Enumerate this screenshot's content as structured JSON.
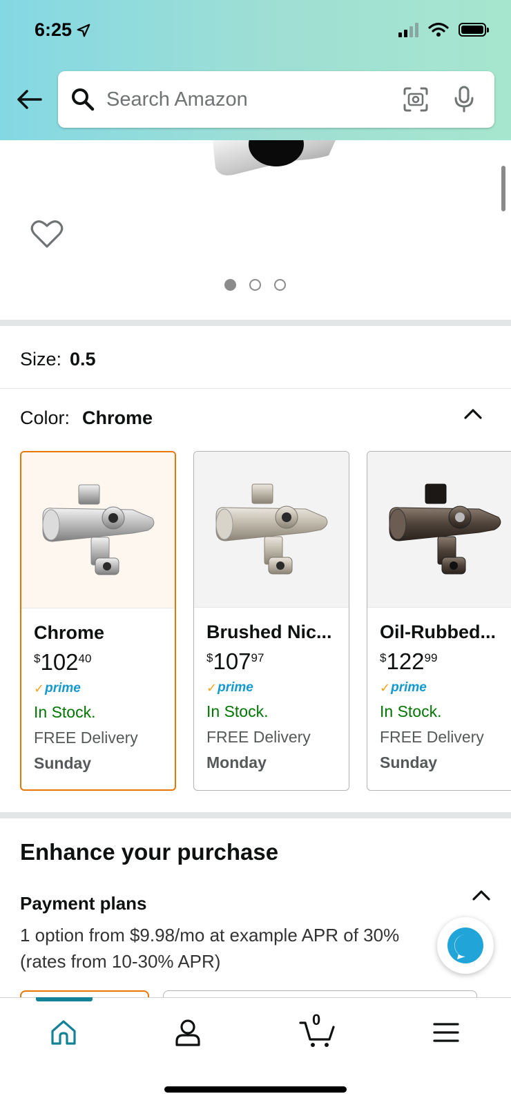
{
  "status_bar": {
    "time": "6:25"
  },
  "search": {
    "placeholder": "Search Amazon"
  },
  "gallery": {
    "page_count": 3,
    "active_index": 0
  },
  "size": {
    "label": "Size:",
    "value": "0.5"
  },
  "color": {
    "label": "Color:",
    "value": "Chrome",
    "options": [
      {
        "name": "Chrome",
        "price_dollars": "102",
        "price_cents": "40",
        "price_symbol": "$",
        "prime": "prime",
        "stock": "In Stock.",
        "delivery": "FREE Delivery",
        "day": "Sunday",
        "selected": true
      },
      {
        "name": "Brushed Nic...",
        "price_dollars": "107",
        "price_cents": "97",
        "price_symbol": "$",
        "prime": "prime",
        "stock": "In Stock.",
        "delivery": "FREE Delivery",
        "day": "Monday",
        "selected": false
      },
      {
        "name": "Oil-Rubbed...",
        "price_dollars": "122",
        "price_cents": "99",
        "price_symbol": "$",
        "prime": "prime",
        "stock": "In Stock.",
        "delivery": "FREE Delivery",
        "day": "Sunday",
        "selected": false
      }
    ]
  },
  "enhance": {
    "title": "Enhance your purchase",
    "payment_title": "Payment plans",
    "payment_desc": "1 option from $9.98/mo at example APR of 30% (rates from 10-30% APR)"
  },
  "bottom_nav": {
    "items": [
      "home-icon",
      "account-icon",
      "cart-icon",
      "menu-icon"
    ],
    "cart_count": "0",
    "active": "home"
  },
  "colors": {
    "accent_teal": "#138296",
    "selected_orange": "#e77600",
    "in_stock_green": "#007600",
    "prime_blue": "#1399cf"
  }
}
